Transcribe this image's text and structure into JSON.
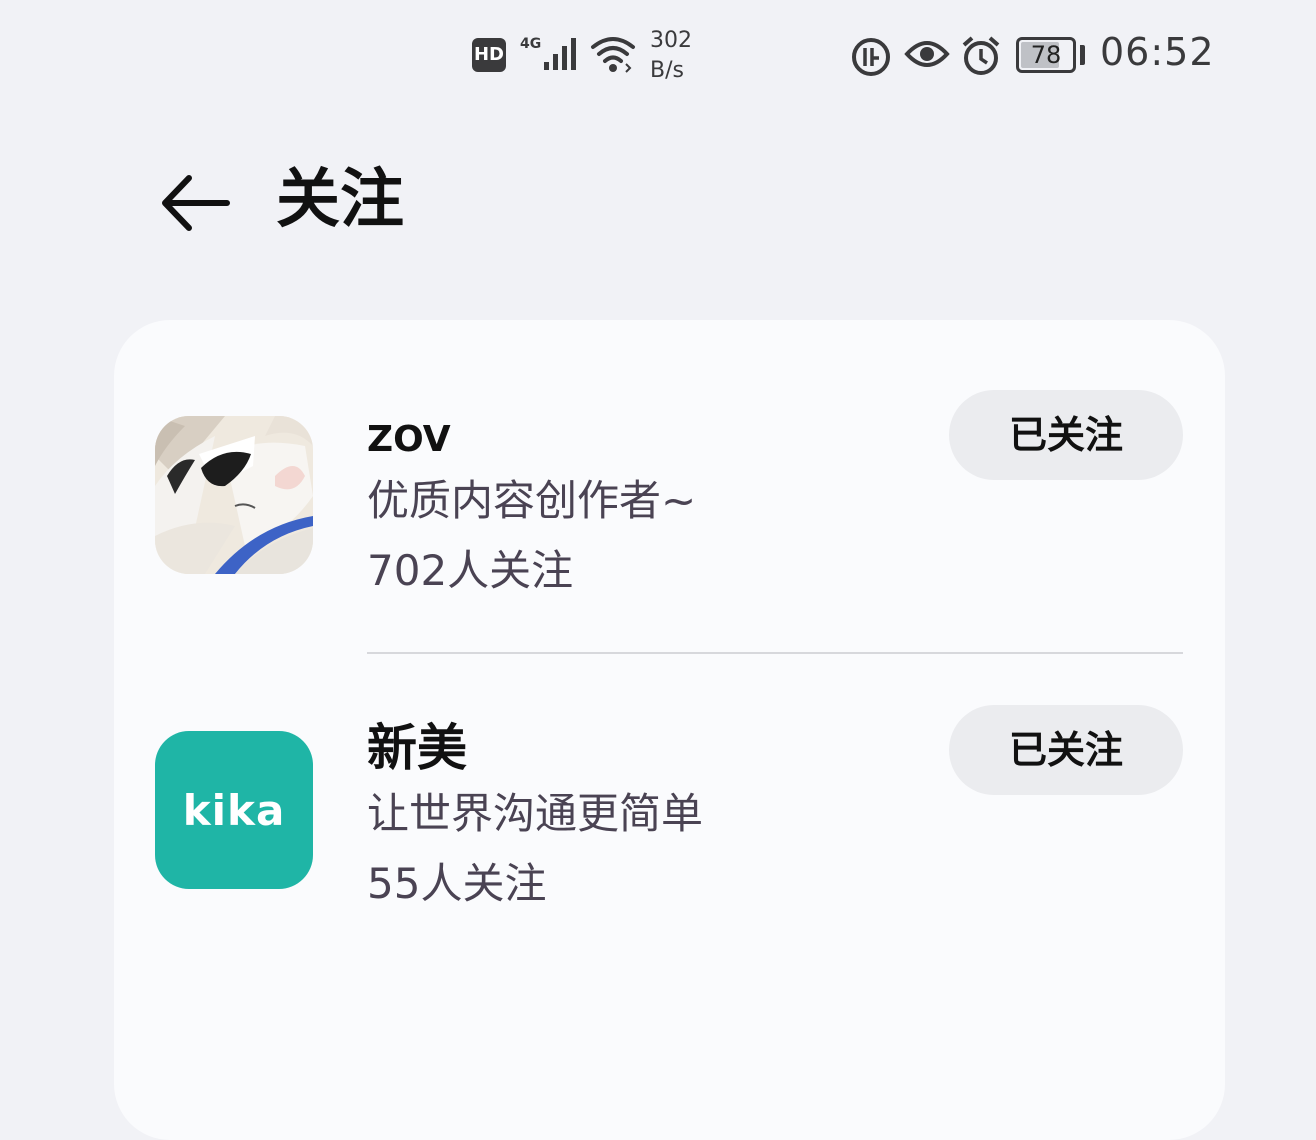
{
  "status_bar": {
    "hd_badge": "HD",
    "network_type": "4G",
    "speed_value": "302",
    "speed_unit": "B/s",
    "battery_level": 78,
    "battery_text": "78",
    "time": "06:52",
    "icons": [
      "hd-badge",
      "signal-icon",
      "wifi-icon",
      "nfc-icon",
      "eye-comfort-icon",
      "alarm-icon",
      "battery-icon"
    ]
  },
  "header": {
    "back_icon": "arrow-left-icon",
    "title": "关注"
  },
  "follows": [
    {
      "name": "ZOV",
      "description": "优质内容创作者~",
      "followers": "702人关注",
      "button_label": "已关注",
      "avatar": "cat-photo"
    },
    {
      "name": "新美",
      "description": "让世界沟通更简单",
      "followers": "55人关注",
      "button_label": "已关注",
      "avatar": "kika-logo",
      "avatar_text": "kika"
    }
  ],
  "colors": {
    "background": "#f1f2f6",
    "card": "#fafbfd",
    "button_bg": "#ebecef",
    "secondary_text": "#4a4353",
    "kika_teal": "#1fb5a6"
  }
}
